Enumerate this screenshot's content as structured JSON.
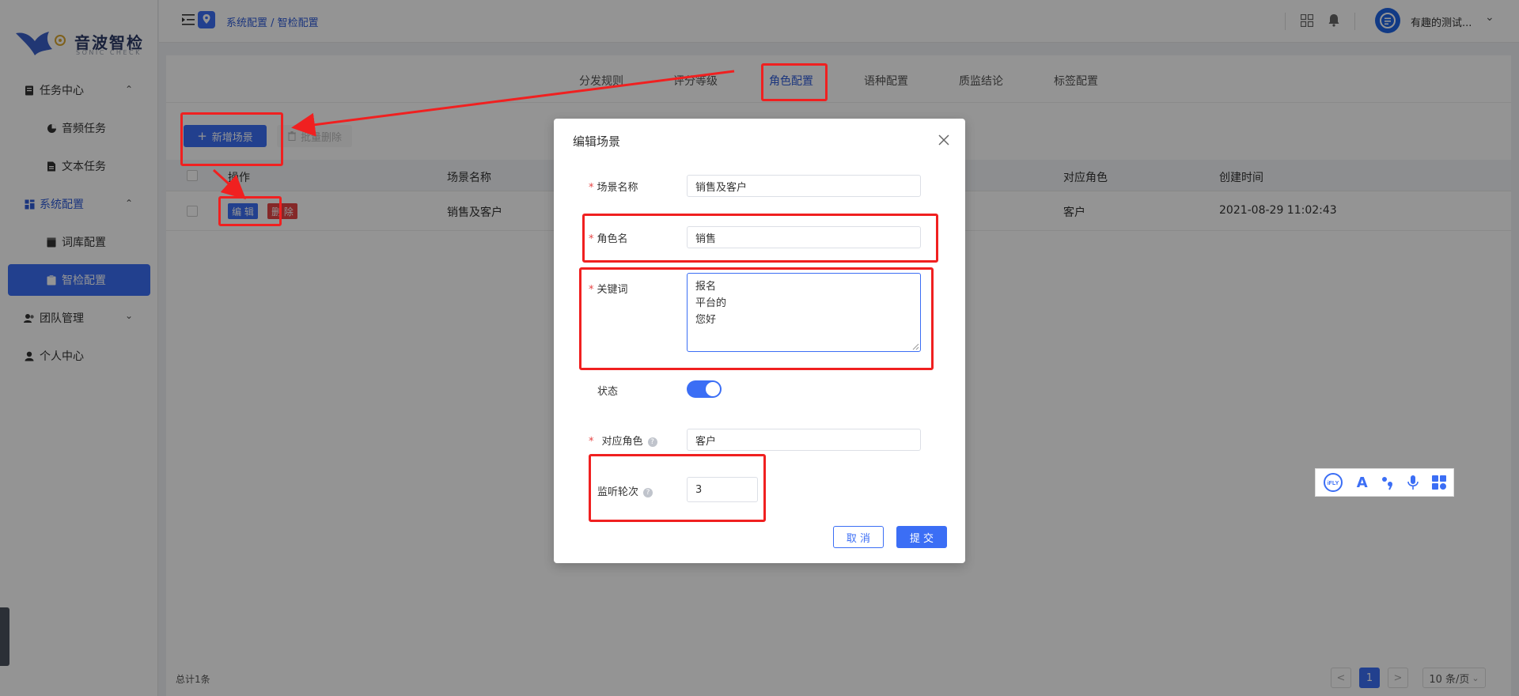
{
  "sidebar": {
    "logo_text": "音波智检",
    "logo_sub": "SONIC CHECK",
    "items": [
      {
        "label": "任务中心"
      },
      {
        "label": "音频任务"
      },
      {
        "label": "文本任务"
      },
      {
        "label": "系统配置"
      },
      {
        "label": "词库配置"
      },
      {
        "label": "智检配置"
      },
      {
        "label": "团队管理"
      },
      {
        "label": "个人中心"
      }
    ]
  },
  "header": {
    "breadcrumb": "系统配置 / 智检配置",
    "user_name": "有趣的测试..."
  },
  "tabs": [
    {
      "label": "分发规则"
    },
    {
      "label": "评分等级"
    },
    {
      "label": "角色配置"
    },
    {
      "label": "语种配置"
    },
    {
      "label": "质监结论"
    },
    {
      "label": "标签配置"
    }
  ],
  "toolbar": {
    "add_label": "新增场景",
    "batch_delete_label": "批量删除"
  },
  "table": {
    "headers": [
      "操作",
      "场景名称",
      "对应角色",
      "创建时间"
    ],
    "rows": [
      {
        "edit": "编 辑",
        "delete": "删 除",
        "scene_name": "销售及客户",
        "role": "客户",
        "created": "2021-08-29 11:02:43"
      }
    ]
  },
  "pagination": {
    "total": "总计1条",
    "prev": "<",
    "current": "1",
    "next": ">",
    "page_size": "10 条/页"
  },
  "dialog": {
    "title": "编辑场景",
    "fields": {
      "scene_name_label": "场景名称",
      "scene_name_value": "销售及客户",
      "role_name_label": "角色名",
      "role_name_value": "销售",
      "keywords_label": "关键词",
      "keywords": [
        "报名",
        "平台的",
        "您好"
      ],
      "status_label": "状态",
      "counterpart_label": "对应角色",
      "counterpart_value": "客户",
      "rounds_label": "监听轮次",
      "rounds_value": "3"
    },
    "cancel_label": "取 消",
    "submit_label": "提 交"
  },
  "ime_toolbar": {
    "brand": "iFLY",
    "text_icon": "A"
  },
  "colors": {
    "primary": "#3b6ef5",
    "danger": "#e64545",
    "annotation": "#f02020"
  }
}
